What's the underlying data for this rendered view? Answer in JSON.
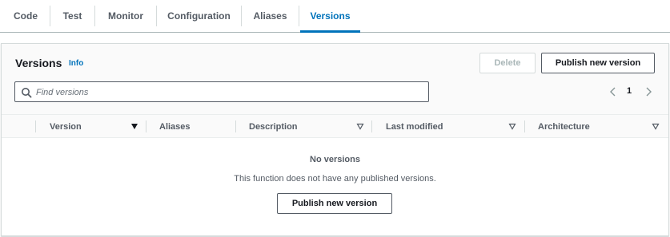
{
  "tabs": [
    {
      "label": "Code"
    },
    {
      "label": "Test"
    },
    {
      "label": "Monitor"
    },
    {
      "label": "Configuration"
    },
    {
      "label": "Aliases"
    },
    {
      "label": "Versions",
      "active": true
    }
  ],
  "panel": {
    "title": "Versions",
    "info_label": "Info",
    "delete_label": "Delete",
    "publish_label": "Publish new version",
    "search_placeholder": "Find versions",
    "current_page": "1"
  },
  "table": {
    "columns": [
      {
        "label": "Version",
        "sort": "sorted-desc"
      },
      {
        "label": "Aliases",
        "sort": "none"
      },
      {
        "label": "Description",
        "sort": "sortable"
      },
      {
        "label": "Last modified",
        "sort": "sortable"
      },
      {
        "label": "Architecture",
        "sort": "sortable"
      }
    ]
  },
  "empty_state": {
    "title": "No versions",
    "description": "This function does not have any published versions.",
    "button_label": "Publish new version"
  },
  "colors": {
    "accent": "#0073bb",
    "text": "#16191f",
    "muted": "#545b64",
    "border": "#d5dbdb"
  }
}
